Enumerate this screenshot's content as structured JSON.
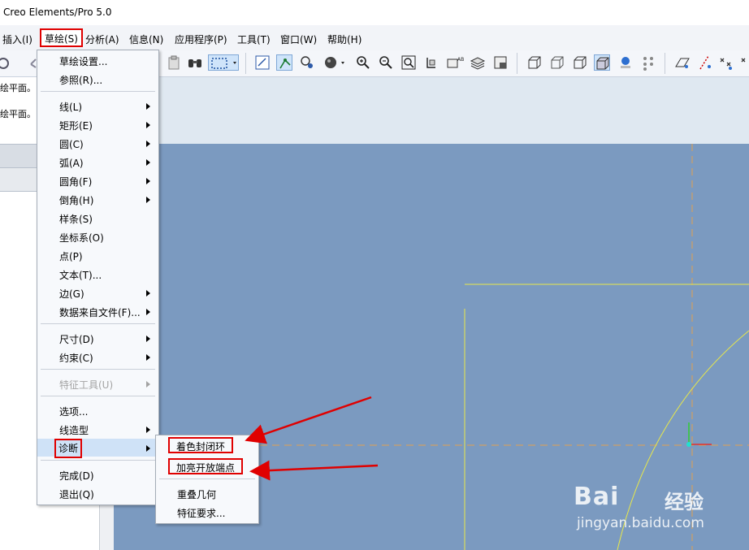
{
  "window": {
    "title": "Creo Elements/Pro 5.0"
  },
  "menubar": {
    "items": [
      {
        "label": "插入(I)"
      },
      {
        "label": "草绘(S)"
      },
      {
        "label": "分析(A)"
      },
      {
        "label": "信息(N)"
      },
      {
        "label": "应用程序(P)"
      },
      {
        "label": "工具(T)"
      },
      {
        "label": "窗口(W)"
      },
      {
        "label": "帮助(H)"
      }
    ]
  },
  "left_panel": {
    "messages": [
      "绘平面。",
      "绘平面。"
    ]
  },
  "sketch_menu": {
    "items": [
      {
        "label": "草绘设置..."
      },
      {
        "label": "参照(R)..."
      },
      {
        "label": "线(L)"
      },
      {
        "label": "矩形(E)"
      },
      {
        "label": "圆(C)"
      },
      {
        "label": "弧(A)"
      },
      {
        "label": "圆角(F)"
      },
      {
        "label": "倒角(H)"
      },
      {
        "label": "样条(S)"
      },
      {
        "label": "坐标系(O)"
      },
      {
        "label": "点(P)"
      },
      {
        "label": "文本(T)..."
      },
      {
        "label": "边(G)"
      },
      {
        "label": "数据来自文件(F)..."
      },
      {
        "label": "尺寸(D)"
      },
      {
        "label": "约束(C)"
      },
      {
        "label": "特征工具(U)"
      },
      {
        "label": "选项..."
      },
      {
        "label": "线造型"
      },
      {
        "label": "诊断"
      },
      {
        "label": "完成(D)"
      },
      {
        "label": "退出(Q)"
      }
    ]
  },
  "diagnose_submenu": {
    "items": [
      {
        "label": "着色封闭环"
      },
      {
        "label": "加亮开放端点"
      },
      {
        "label": "重叠几何"
      },
      {
        "label": "特征要求..."
      }
    ]
  },
  "watermark": {
    "brand": "Bai",
    "brand_cn": "经验",
    "url": "jingyan.baidu.com"
  },
  "colors": {
    "canvas": "#7b9ac0",
    "highlight_box": "#e00000",
    "sketch_line": "#e8e84a",
    "centerline": "#e0a050"
  }
}
